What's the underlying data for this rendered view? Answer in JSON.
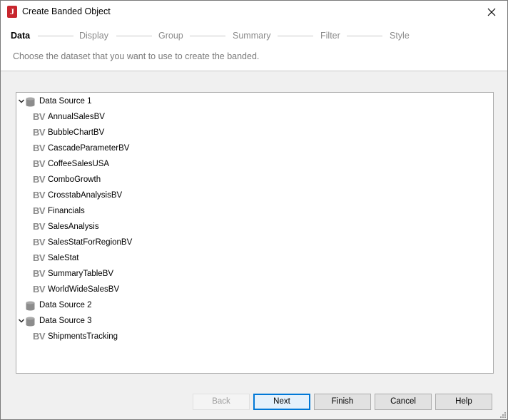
{
  "window": {
    "title": "Create Banded Object",
    "app_icon_letter": "J"
  },
  "wizard": {
    "steps": [
      {
        "label": "Data",
        "active": true
      },
      {
        "label": "Display",
        "active": false
      },
      {
        "label": "Group",
        "active": false
      },
      {
        "label": "Summary",
        "active": false
      },
      {
        "label": "Filter",
        "active": false
      },
      {
        "label": "Style",
        "active": false
      }
    ],
    "instruction": "Choose the dataset that you want to use to create the banded."
  },
  "tree": {
    "icon_text": "BV",
    "sources": [
      {
        "name": "Data Source 1",
        "expanded": true,
        "items": [
          "AnnualSalesBV",
          "BubbleChartBV",
          "CascadeParameterBV",
          "CoffeeSalesUSA",
          "ComboGrowth",
          "CrosstabAnalysisBV",
          "Financials",
          "SalesAnalysis",
          "SalesStatForRegionBV",
          "SaleStat",
          "SummaryTableBV",
          "WorldWideSalesBV"
        ]
      },
      {
        "name": "Data Source 2",
        "expanded": false,
        "items": []
      },
      {
        "name": "Data Source 3",
        "expanded": true,
        "items": [
          "ShipmentsTracking"
        ]
      }
    ]
  },
  "buttons": {
    "back": "Back",
    "next": "Next",
    "finish": "Finish",
    "cancel": "Cancel",
    "help": "Help"
  }
}
